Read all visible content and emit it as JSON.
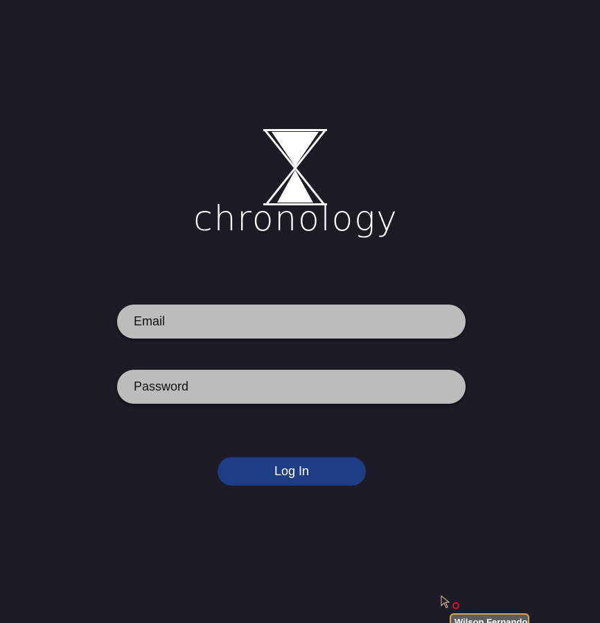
{
  "app": {
    "brand_name": "chronology",
    "logo_icon": "hourglass-icon"
  },
  "login_form": {
    "email_placeholder": "Email",
    "email_value": "",
    "password_placeholder": "Password",
    "password_value": "",
    "submit_label": "Log In"
  },
  "overlay": {
    "cursor_label": "Wilson Fernando"
  },
  "colors": {
    "background": "#1c1b26",
    "field_background": "#bcbcbc",
    "button_background": "#1d3d85",
    "text_light": "#ffffff",
    "cursor_accent": "#d4163c",
    "cursor_tag_border": "#e0a25c"
  }
}
